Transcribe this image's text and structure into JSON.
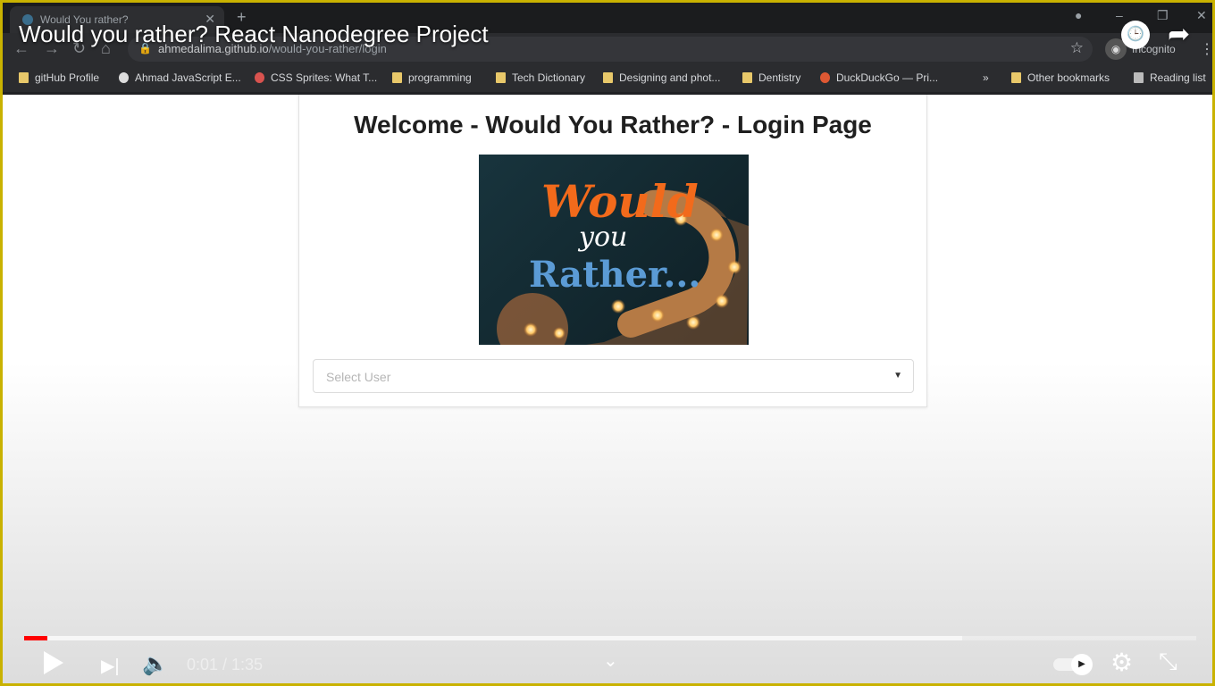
{
  "browser": {
    "tab_title": "Would You rather?",
    "url_host": "ahmedalima.github.io",
    "url_path": "/would-you-rather/login",
    "incognito_label": "Incognito",
    "bookmarks": [
      {
        "label": "gitHub Profile",
        "icon": "folder-icon"
      },
      {
        "label": "Ahmad JavaScript E...",
        "icon": "globe-icon"
      },
      {
        "label": "CSS Sprites: What T...",
        "icon": "star-icon"
      },
      {
        "label": "programming",
        "icon": "folder-icon"
      },
      {
        "label": "Tech Dictionary",
        "icon": "folder-icon"
      },
      {
        "label": "Designing and phot...",
        "icon": "folder-icon"
      },
      {
        "label": "Dentistry",
        "icon": "folder-icon"
      },
      {
        "label": "DuckDuckGo — Pri...",
        "icon": "duckduckgo-icon"
      },
      {
        "label": "»",
        "icon": "more-icon"
      },
      {
        "label": "Other bookmarks",
        "icon": "folder-icon"
      },
      {
        "label": "Reading list",
        "icon": "reading-list-icon"
      }
    ]
  },
  "video": {
    "title": "Would you rather? React Nanodegree Project",
    "current_time": "0:01",
    "duration": "1:35",
    "time_display": "0:01 / 1:35",
    "played_fraction": 0.02,
    "loaded_fraction": 0.8
  },
  "page": {
    "heading": "Welcome - Would You Rather? - Login Page",
    "poster_text": {
      "line1": "Would",
      "line2": "you",
      "line3": "Rather..."
    },
    "select_placeholder": "Select User"
  },
  "colors": {
    "frame_border": "#c9b200",
    "progress_played": "#ff0000",
    "poster_orange": "#f26a1b",
    "poster_blue": "#5b9bd5"
  }
}
